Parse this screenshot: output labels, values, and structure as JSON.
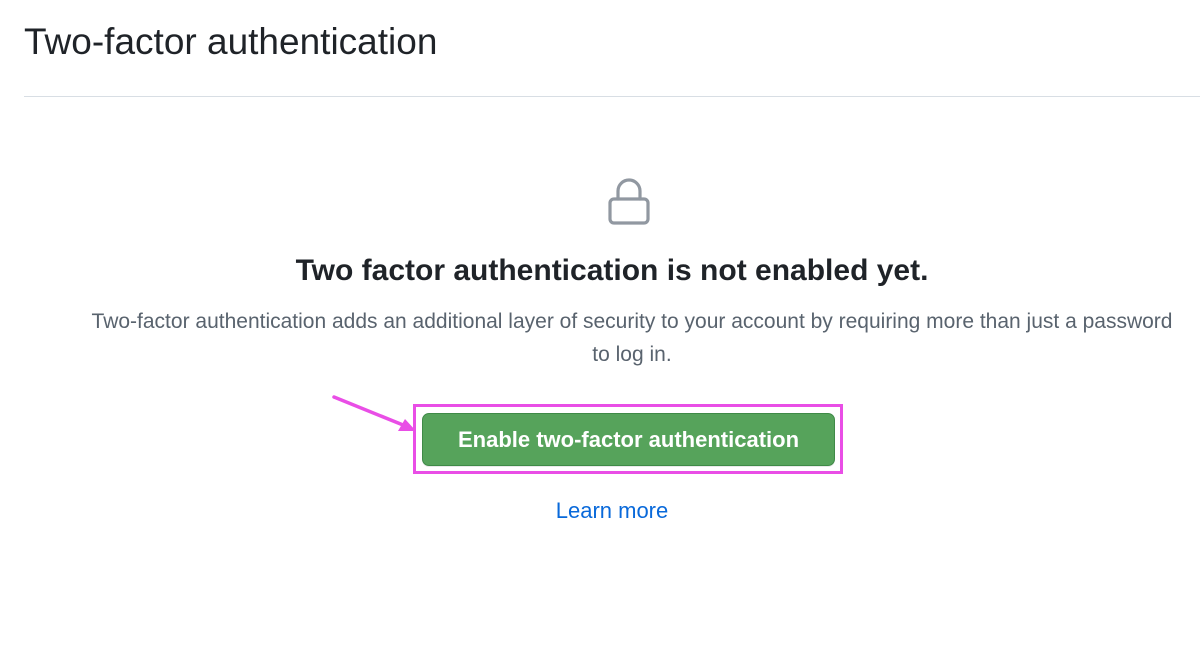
{
  "header": {
    "title": "Two-factor authentication"
  },
  "blankslate": {
    "icon": "lock-icon",
    "title": "Two factor authentication is not enabled yet.",
    "description": "Two-factor authentication adds an additional layer of security to your account by requiring more than just a password to log in.",
    "enable_button_label": "Enable two-factor authentication",
    "learn_more_label": "Learn more"
  },
  "colors": {
    "button_green": "#56a35b",
    "link_blue": "#0969da",
    "annotation_magenta": "#e94ee6",
    "icon_gray": "#9198a1"
  }
}
